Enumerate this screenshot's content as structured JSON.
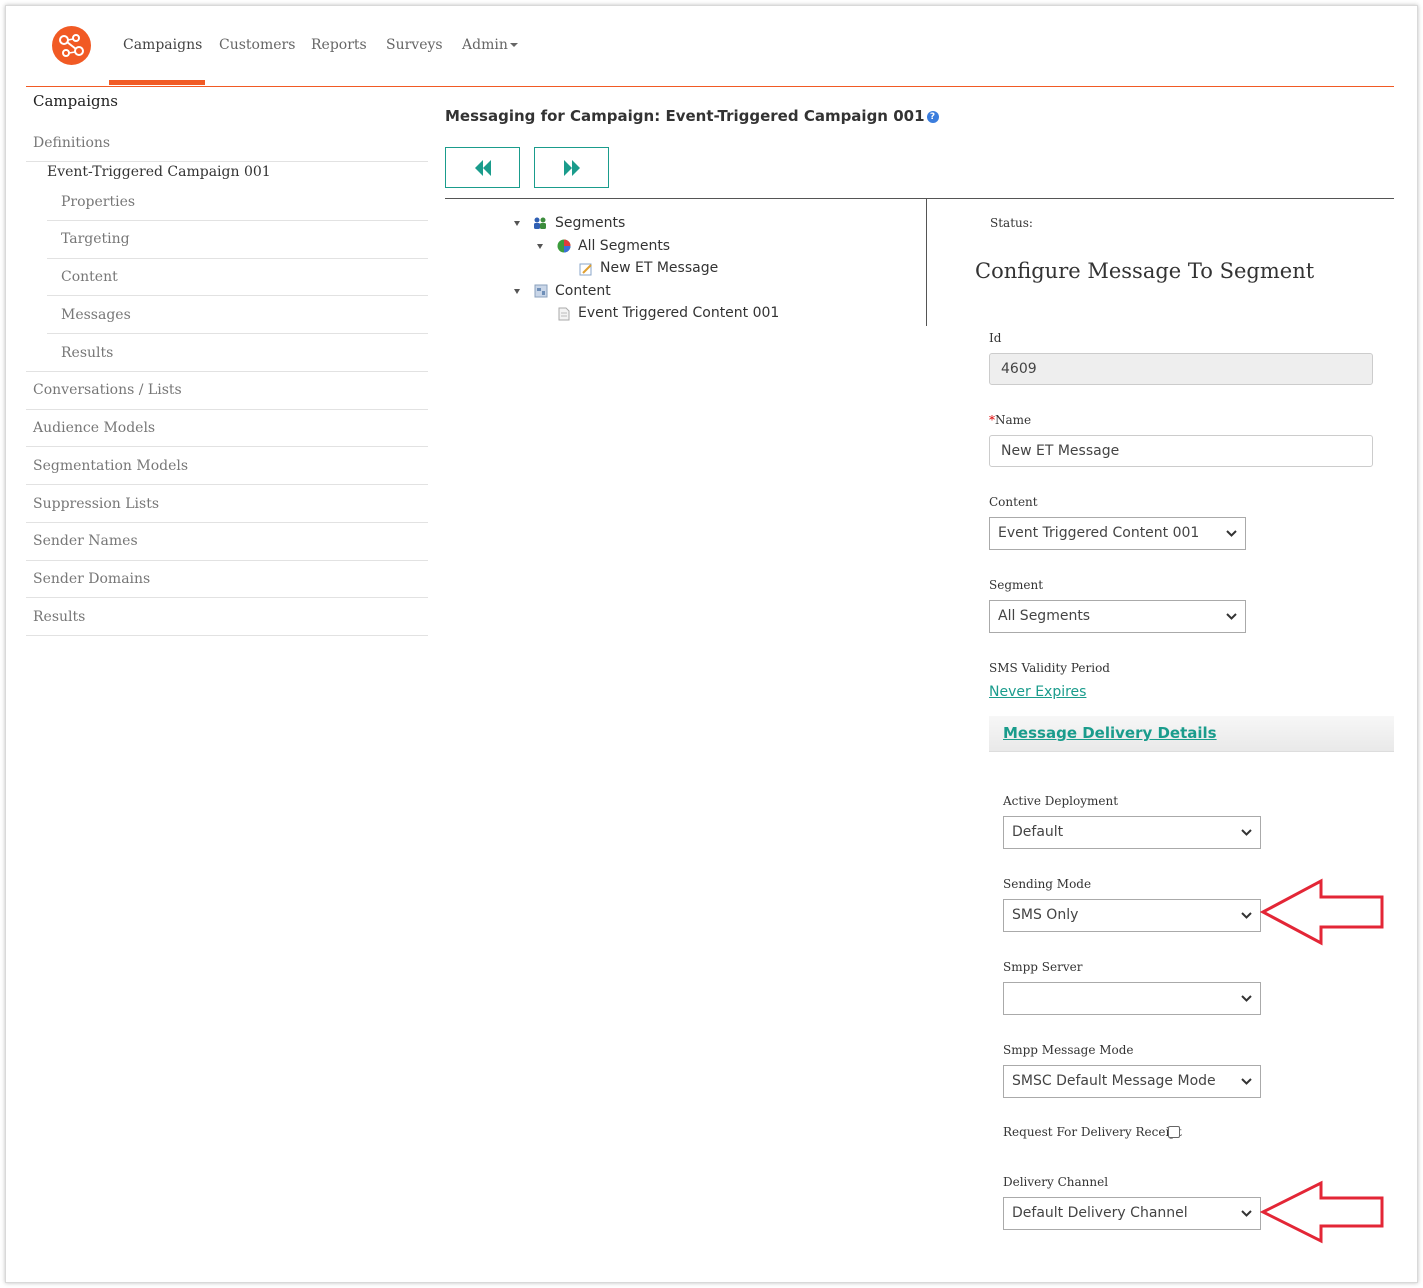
{
  "nav": {
    "items": [
      {
        "label": "Campaigns",
        "active": true
      },
      {
        "label": "Customers"
      },
      {
        "label": "Reports"
      },
      {
        "label": "Surveys"
      },
      {
        "label": "Admin"
      }
    ],
    "accent_color": "#f15a24"
  },
  "sidebar": {
    "title": "Campaigns",
    "definitions": "Definitions",
    "campaign": "Event-Triggered Campaign 001",
    "sub_items": [
      "Properties",
      "Targeting",
      "Content",
      "Messages",
      "Results"
    ],
    "items": [
      "Conversations / Lists",
      "Audience Models",
      "Segmentation Models",
      "Suppression Lists",
      "Sender Names",
      "Sender Domains",
      "Results"
    ]
  },
  "main": {
    "title": "Messaging for Campaign: Event-Triggered Campaign 001",
    "help_icon": "help-icon",
    "buttons": {
      "back": "rewind-icon",
      "forward": "fast-forward-icon"
    }
  },
  "tree": {
    "segments": "Segments",
    "all_segments": "All Segments",
    "message": "New ET Message",
    "content": "Content",
    "content_item": "Event Triggered Content 001"
  },
  "form": {
    "status_label": "Status:",
    "heading": "Configure Message To Segment",
    "id_label": "Id",
    "id_value": "4609",
    "name_required": "*",
    "name_label": "Name",
    "name_value": "New ET Message",
    "content_label": "Content",
    "content_value": "Event Triggered Content 001",
    "segment_label": "Segment",
    "segment_value": "All Segments",
    "sms_validity_label": "SMS Validity Period",
    "sms_validity_value": "Never Expires",
    "delivery_section": "Message Delivery Details",
    "active_deployment_label": "Active Deployment",
    "active_deployment_value": "Default",
    "sending_mode_label": "Sending Mode",
    "sending_mode_value": "SMS Only",
    "smpp_server_label": "Smpp Server",
    "smpp_server_value": "",
    "smpp_message_mode_label": "Smpp Message Mode",
    "smpp_message_mode_value": "SMSC Default Message Mode",
    "delivery_receipt_label": "Request For Delivery Receipt",
    "delivery_receipt_checked": false,
    "delivery_channel_label": "Delivery Channel",
    "delivery_channel_value": "Default Delivery Channel"
  },
  "colors": {
    "teal": "#1a9c8c",
    "annotation_red": "#e32636"
  }
}
